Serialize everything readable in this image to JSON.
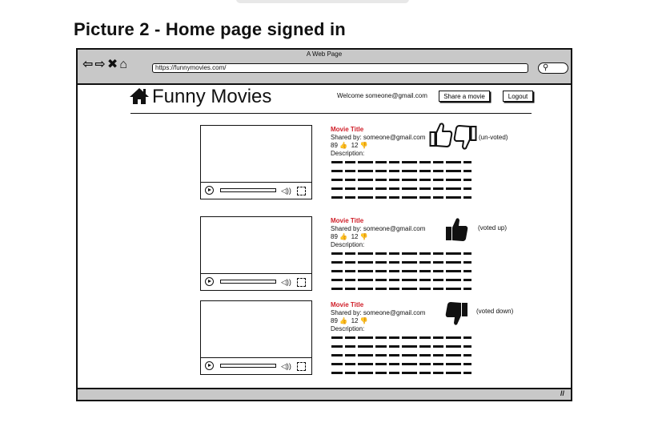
{
  "document_title": "Picture 2 - Home page signed in",
  "browser": {
    "window_title": "A Web Page",
    "url": "https://funnymovies.com/"
  },
  "header": {
    "logo_text": "Funny Movies",
    "welcome": "Welcome someone@gmail.com",
    "share_button": "Share a movie",
    "logout_button": "Logout"
  },
  "movies": [
    {
      "title": "Movie Title",
      "shared_by": "Shared by: someone@gmail.com",
      "likes": "89",
      "dislikes": "12",
      "description_label": "Description:",
      "vote_state": "(un-voted)"
    },
    {
      "title": "Movie Title",
      "shared_by": "Shared by: someone@gmail.com",
      "likes": "89",
      "dislikes": "12",
      "description_label": "Description:",
      "vote_state": "(voted up)"
    },
    {
      "title": "Movie Title",
      "shared_by": "Shared by: someone@gmail.com",
      "likes": "89",
      "dislikes": "12",
      "description_label": "Description:",
      "vote_state": "(voted down)"
    }
  ],
  "colors": {
    "movie_title": "#d0202a",
    "chrome_grey": "#c8c8c8"
  }
}
